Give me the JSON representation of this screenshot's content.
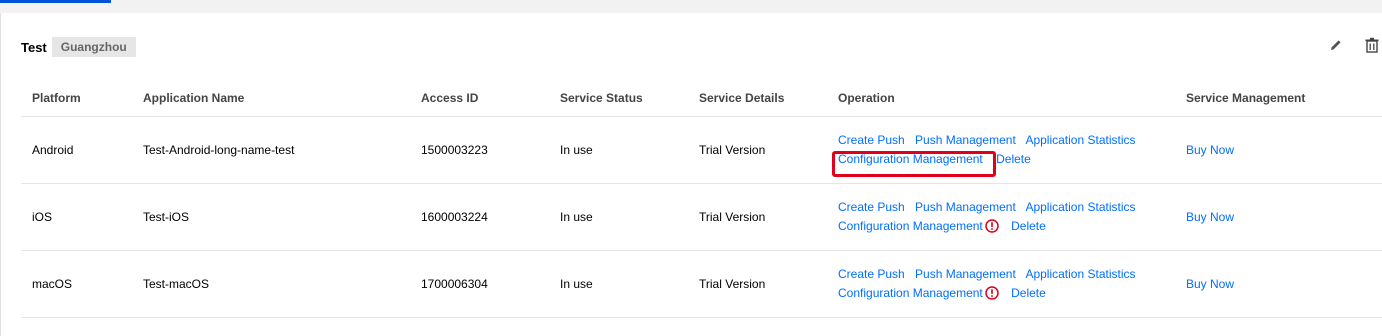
{
  "group": {
    "title": "Test",
    "region": "Guangzhou"
  },
  "table": {
    "headers": [
      "Platform",
      "Application Name",
      "Access ID",
      "Service Status",
      "Service Details",
      "Operation",
      "Service Management"
    ],
    "rows": [
      {
        "platform": "Android",
        "app_name": "Test-Android-long-name-test",
        "access_id": "1500003223",
        "status": "In use",
        "details": "Trial Version",
        "ops": {
          "create_push": "Create Push",
          "push_mgmt": "Push Management",
          "app_stats": "Application Statistics",
          "config_mgmt": "Configuration Management",
          "delete": "Delete"
        },
        "warning": false,
        "buy": "Buy Now"
      },
      {
        "platform": "iOS",
        "app_name": "Test-iOS",
        "access_id": "1600003224",
        "status": "In use",
        "details": "Trial Version",
        "ops": {
          "create_push": "Create Push",
          "push_mgmt": "Push Management",
          "app_stats": "Application Statistics",
          "config_mgmt": "Configuration Management",
          "delete": "Delete"
        },
        "warning": true,
        "buy": "Buy Now"
      },
      {
        "platform": "macOS",
        "app_name": "Test-macOS",
        "access_id": "1700006304",
        "status": "In use",
        "details": "Trial Version",
        "ops": {
          "create_push": "Create Push",
          "push_mgmt": "Push Management",
          "app_stats": "Application Statistics",
          "config_mgmt": "Configuration Management",
          "delete": "Delete"
        },
        "warning": true,
        "buy": "Buy Now"
      }
    ]
  },
  "colors": {
    "link": "#006eff",
    "in_use": "#0abf5b",
    "trial": "#ff7200",
    "warning": "#e0001b",
    "highlight": "#e0001b",
    "tab_indicator": "#0052d9"
  },
  "icons": {
    "edit": "pencil-icon",
    "delete": "trash-icon",
    "warning": "exclamation-circle-icon"
  }
}
